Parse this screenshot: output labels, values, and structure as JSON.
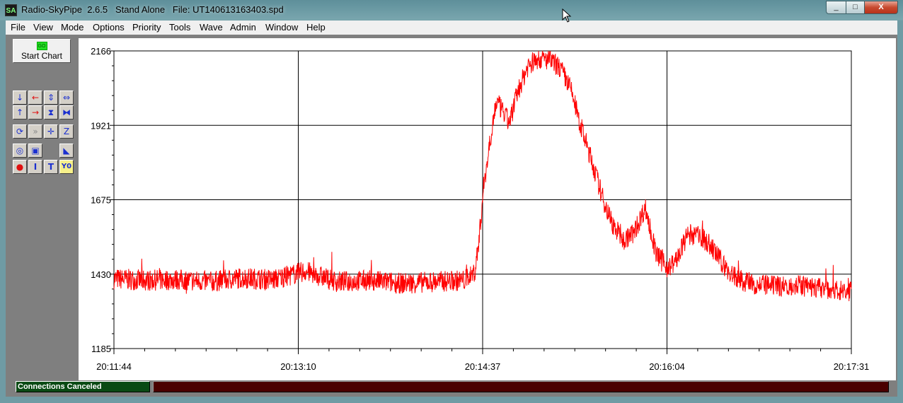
{
  "window": {
    "icon_text": "SA",
    "title": "Radio-SkyPipe  2.6.5   Stand Alone   File: UT140613163403.spd",
    "minimize_glyph": "_",
    "maximize_glyph": "□",
    "close_glyph": "X"
  },
  "menu": [
    "File",
    "View",
    "Mode",
    "Options",
    "Priority",
    "Tools",
    "Wave",
    "Admin",
    "Window",
    "Help"
  ],
  "toolbar": {
    "start_icon_text": "GO",
    "start_label": "Start Chart",
    "buttons": [
      {
        "name": "scroll-down",
        "glyph": "↓",
        "color": "blue"
      },
      {
        "name": "scroll-left",
        "glyph": "←",
        "color": "red"
      },
      {
        "name": "expand-vertical",
        "glyph": "⇕",
        "color": "blue"
      },
      {
        "name": "expand-horizontal",
        "glyph": "⇔",
        "color": "blue"
      },
      {
        "name": "scroll-up",
        "glyph": "↑",
        "color": "blue"
      },
      {
        "name": "scroll-right",
        "glyph": "→",
        "color": "red"
      },
      {
        "name": "compress-vertical",
        "glyph": "⧗",
        "color": "blue"
      },
      {
        "name": "compress-horizontal",
        "glyph": "⧓",
        "color": "blue"
      },
      {
        "name": "refresh",
        "glyph": "⟳",
        "color": "blue"
      },
      {
        "name": "fast-forward",
        "glyph": "»",
        "color": "grey"
      },
      {
        "name": "crosshair",
        "glyph": "✛",
        "color": "blue"
      },
      {
        "name": "zoom",
        "glyph": "Z",
        "color": "blue"
      },
      {
        "name": "center",
        "glyph": "◎",
        "color": "blue"
      },
      {
        "name": "select-region",
        "glyph": "▣",
        "color": "blue"
      },
      {
        "name": "marker",
        "glyph": "◣",
        "color": "blue"
      },
      {
        "name": "record",
        "glyph": "●",
        "color": "red"
      },
      {
        "name": "insert-text",
        "glyph": "I",
        "color": "blue"
      },
      {
        "name": "title-text",
        "glyph": "T",
        "color": "blue"
      },
      {
        "name": "y-zero",
        "glyph": "Y0",
        "color": "blue"
      }
    ]
  },
  "chart_data": {
    "type": "line",
    "y_ticks": [
      "2166",
      "1921",
      "1675",
      "1430",
      "1185"
    ],
    "x_ticks": [
      "20:11:44",
      "20:13:10",
      "20:14:37",
      "20:16:04",
      "20:17:31"
    ],
    "ylim": [
      1185,
      2166
    ],
    "grid": true,
    "series_color": "#ff0000",
    "x_seconds_from_start": [
      0,
      15,
      30,
      45,
      60,
      75,
      90,
      105,
      120,
      135,
      150,
      165,
      170,
      172,
      174,
      178,
      180,
      183,
      186,
      190,
      195,
      200,
      205,
      210,
      215,
      220,
      225,
      230,
      235,
      240,
      245,
      250,
      255,
      258,
      261,
      265,
      270,
      275,
      280,
      285,
      290,
      295,
      300,
      310,
      320,
      330,
      340,
      347
    ],
    "values": [
      1415,
      1410,
      1412,
      1405,
      1418,
      1412,
      1440,
      1405,
      1410,
      1400,
      1405,
      1410,
      1440,
      1560,
      1720,
      1920,
      2000,
      1965,
      1930,
      2030,
      2120,
      2140,
      2135,
      2110,
      2040,
      1910,
      1800,
      1680,
      1590,
      1540,
      1570,
      1650,
      1500,
      1470,
      1450,
      1480,
      1560,
      1560,
      1530,
      1480,
      1430,
      1410,
      1400,
      1390,
      1395,
      1385,
      1380,
      1370
    ],
    "noise_amplitude": 35
  },
  "status": {
    "left": "Connections Canceled",
    "right": ""
  }
}
